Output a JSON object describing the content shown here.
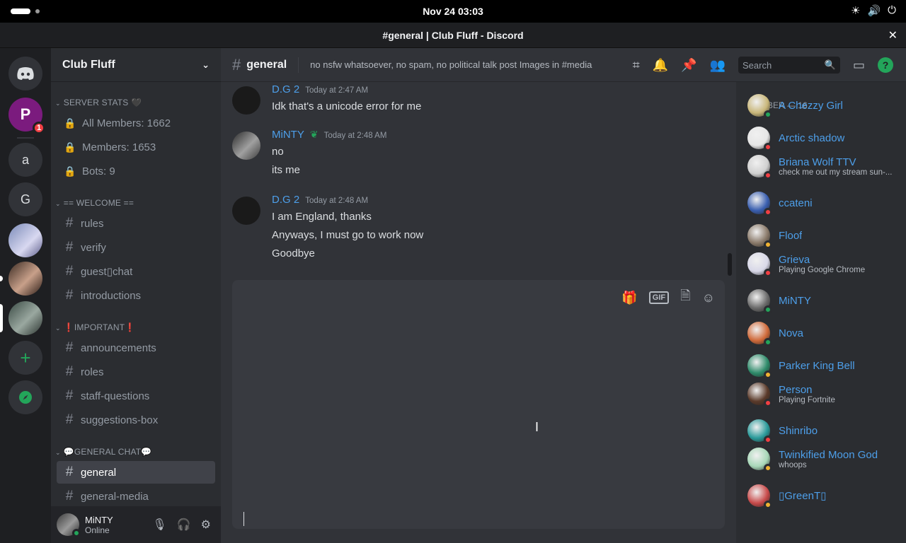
{
  "system": {
    "clock": "Nov 24  03:03",
    "window_title": "#general | Club Fluff - Discord",
    "close_glyph": "✕"
  },
  "guilds": {
    "items": [
      {
        "label": "",
        "icon": "discord-icon"
      },
      {
        "label": "P",
        "badge": "1"
      },
      {
        "label": "a"
      },
      {
        "label": "G"
      },
      {
        "label": ""
      },
      {
        "label": ""
      },
      {
        "label": ""
      },
      {
        "label": "+",
        "icon": "add-server-icon"
      },
      {
        "label": "⊘",
        "icon": "explore-icon"
      }
    ]
  },
  "server": {
    "name": "Club Fluff",
    "categories": {
      "server_stats": "SERVER STATS 🖤",
      "welcome": "== WELCOME ==",
      "important": "❗IMPORTANT❗",
      "general_chat": "💬GENERAL CHAT💬"
    },
    "stats": [
      "All Members: 1662",
      "Members: 1653",
      "Bots: 9"
    ],
    "welcome_channels": [
      "rules",
      "verify",
      "guest▯chat",
      "introductions"
    ],
    "important_channels": [
      "announcements",
      "roles",
      "staff-questions",
      "suggestions-box"
    ],
    "general_channels": [
      "general",
      "general-media"
    ]
  },
  "user": {
    "name": "MiNTY",
    "status": "Online"
  },
  "channel": {
    "name": "general",
    "topic": "no nsfw whatsoever, no spam, no political talk post Images in #media",
    "search_placeholder": "Search"
  },
  "messages": [
    {
      "author": "D.G 2",
      "time": "Today at 2:47 AM",
      "lines": [
        "Idk that's a unicode error for me"
      ]
    },
    {
      "author": "MiNTY",
      "time": "Today at 2:48 AM",
      "lines": [
        "no",
        "its me"
      ]
    },
    {
      "author": "D.G 2",
      "time": "Today at 2:48 AM",
      "lines": [
        "I am England, thanks",
        "Anyways, I must go to work now",
        "Goodbye"
      ]
    }
  ],
  "composer": {
    "gif_label": "GIF"
  },
  "members": {
    "header": "MEMBER — 16",
    "list": [
      {
        "name": "A Chezzy Girl",
        "sub": "",
        "status": "online",
        "color": "#c9b77a"
      },
      {
        "name": "Arctic shadow",
        "sub": "",
        "status": "dnd",
        "color": "#e6e6e6"
      },
      {
        "name": "Briana Wolf TTV",
        "sub": "check me out my stream sun-...",
        "status": "dnd",
        "color": "#d0d0d0"
      },
      {
        "name": "ccateni",
        "sub": "",
        "status": "dnd",
        "color": "#3a5fb0"
      },
      {
        "name": "Floof",
        "sub": "",
        "status": "idle",
        "color": "#8a7a6a"
      },
      {
        "name": "Grieva",
        "sub": "Playing Google Chrome",
        "status": "dnd",
        "color": "#d8d8e8"
      },
      {
        "name": "MiNTY",
        "sub": "",
        "status": "online",
        "color": "#6b6b6b"
      },
      {
        "name": "Nova",
        "sub": "",
        "status": "online",
        "color": "#d06a3a"
      },
      {
        "name": "Parker King Bell",
        "sub": "",
        "status": "idle",
        "color": "#2e8b6a"
      },
      {
        "name": "Person",
        "sub": "Playing Fortnite",
        "status": "dnd",
        "color": "#5a3a2a"
      },
      {
        "name": "Shinribo",
        "sub": "",
        "status": "dnd",
        "color": "#2a9a9a"
      },
      {
        "name": "Twinkified Moon God",
        "sub": "whoops",
        "status": "idle",
        "color": "#a8d8b8"
      },
      {
        "name": "▯GreenT▯",
        "sub": "",
        "status": "idle",
        "color": "#c84a4a"
      }
    ]
  },
  "colors": {
    "accent_link": "#4d9fea",
    "online": "#23a55a",
    "dnd": "#f23f43",
    "idle": "#f0b232"
  }
}
